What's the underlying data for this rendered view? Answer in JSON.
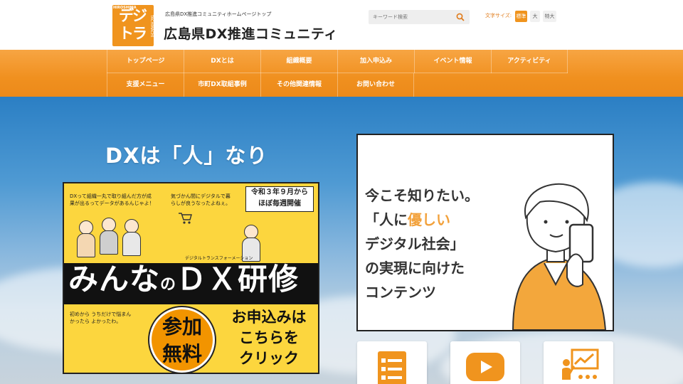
{
  "header": {
    "logo": {
      "big_top": "デジ",
      "big_bottom": "トラ",
      "cap": "HIROSHIMA",
      "side": "TACHIMACHI"
    },
    "tagline": "広島県DX推進コミュニティホームページトップ",
    "site_title": "広島県DX推進コミュニティ",
    "search": {
      "placeholder": "キーワード検索"
    },
    "font_size": {
      "label": "文字サイズ:",
      "standard": "標準",
      "large": "大",
      "extra_large": "特大"
    }
  },
  "nav": {
    "row1": [
      "トップページ",
      "DXとは",
      "組織概要",
      "加入申込み",
      "イベント情報",
      "アクティビティ"
    ],
    "row2": [
      "支援メニュー",
      "市町DX取組事例",
      "その他関連情報",
      "お問い合わせ"
    ]
  },
  "hero": {
    "heading": "DXは「人」なり",
    "banner": {
      "speech1": "DXって組織一丸で取り組んだ方が成果が出るってデータがあるんじゃよ！",
      "speech2": "気づかん間にデジタルで暮らしが良うなったよねぇ。",
      "schedule_line1": "令和３年９月から",
      "schedule_line2": "ほぼ毎週開催",
      "subtitle": "デジタルトランスフォーメーション",
      "title_a": "みんな",
      "title_b": "の",
      "title_c": "ＤＸ研修",
      "lower_left": "初めから うちだけで悩まんかったら よかったわ。",
      "free_line1": "参加",
      "free_line2": "無料",
      "apply_line1": "お申込みは",
      "apply_line2": "こちらを",
      "apply_line3": "クリック"
    },
    "card": {
      "line1": "今こそ知りたい。",
      "line2_a": "「人に",
      "line2_b": "優しい",
      "line3": "デジタル社会」",
      "line4": "の実現に向けた",
      "line5": "コンテンツ"
    }
  },
  "colors": {
    "accent": "#f0941e",
    "nav": "#f0901f",
    "banner": "#fcd63e"
  }
}
